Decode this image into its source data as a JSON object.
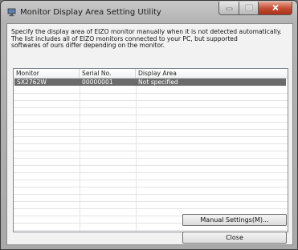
{
  "window": {
    "title": "Monitor Display Area Setting Utility",
    "icon": "monitor-app-icon",
    "controls": [
      "minimize-icon",
      "maximize-icon",
      "close-icon"
    ]
  },
  "description": {
    "line1": "Specify the display area of EIZO monitor manually when it is not detected automatically.",
    "line2": "The list includes all of EIZO monitors connected to your PC, but supported",
    "line3": "softwares of ours differ depending on the monitor."
  },
  "list": {
    "columns": [
      "Monitor",
      "Serial No.",
      "Display Area"
    ],
    "rows": [
      {
        "monitor": "SX2762W",
        "serial": "00000001",
        "area": "Not specified",
        "selected": true
      }
    ]
  },
  "buttons": {
    "manual_settings": "Manual Settings(M)...",
    "close": "Close"
  },
  "colors": {
    "selected_row": "#6b6b6b",
    "close_button": "#c24a2e"
  }
}
